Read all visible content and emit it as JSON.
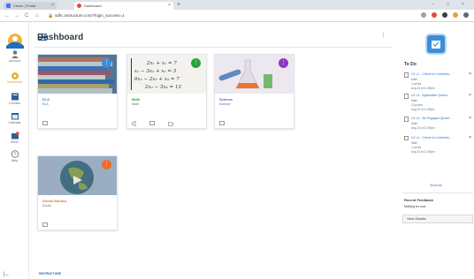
{
  "browser": {
    "tabs": [
      {
        "label": "Clever | Portal",
        "active": false,
        "favicon_color": "#4274f6"
      },
      {
        "label": "Dashboard",
        "active": true,
        "favicon_color": "#e94b3c"
      }
    ],
    "new_tab": "+",
    "window_controls": [
      "–",
      "□",
      "×"
    ],
    "url": "sdhc.instructure.com/?login_success=1",
    "nav_buttons": [
      "←",
      "→",
      "C",
      "⌂"
    ]
  },
  "global_nav": {
    "logo": "canvas-logo",
    "items": [
      {
        "label": "Account",
        "icon": "account-icon",
        "active": false
      },
      {
        "label": "Dashboard",
        "icon": "dashboard-icon",
        "active": true
      },
      {
        "label": "Courses",
        "icon": "courses-icon",
        "active": false
      },
      {
        "label": "Calendar",
        "icon": "calendar-icon",
        "active": false
      },
      {
        "label": "Inbox",
        "icon": "inbox-icon",
        "active": false
      },
      {
        "label": "Help",
        "icon": "help-icon",
        "active": false
      }
    ],
    "collapse": "|←"
  },
  "dashboard": {
    "title": "Dashboard",
    "more": "⋮",
    "cards": [
      {
        "title": "ELA",
        "subtitle": "ELA",
        "color": "#3d8dd8",
        "badge": "",
        "image": "books"
      },
      {
        "title": "Math",
        "subtitle": "Math",
        "color": "#2aa13b",
        "badge": "",
        "image": "equations",
        "equations": [
          "2x₁ + x₂ = 7",
          "x₁ − 3x₂ + x₃ = 3",
          "6x₂ − 2x₃ + x₄ = 7",
          "2x₃ − 3x₄ = 13"
        ]
      },
      {
        "title": "Science",
        "subtitle": "Science",
        "color": "#8b38c2",
        "badge": "",
        "image": "lab"
      },
      {
        "title": "Social Studies",
        "subtitle": "Social",
        "color": "#ee6b2d",
        "badge": "",
        "image": "globe"
      }
    ]
  },
  "sidebar": {
    "todo_title": "To Do",
    "todo": [
      {
        "title": "U1 L1 - Check for Understa...",
        "course": "Math",
        "points": "1 points",
        "due": "Aug 23 at 11:59pm"
      },
      {
        "title": "U1 L4 - Application Questi...",
        "course": "Math",
        "points": "10 points",
        "due": "Aug 23 at 11:59pm"
      },
      {
        "title": "U1 L4 - Be Engaged Questi...",
        "course": "Math",
        "points": "",
        "due": "Aug 23 at 11:59pm"
      },
      {
        "title": "U1 L4 - Check for Understa...",
        "course": "Math",
        "points": "1 points",
        "due": "Aug 23 at 11:59pm"
      }
    ],
    "show_all": "Show All",
    "feedback_title": "Recent Feedback",
    "feedback_text": "Nothing for now",
    "view_grades": "View Grades"
  },
  "footer": {
    "brand": "INSTRUCTURE",
    "links": "Privacy Policy    Acceptable Use Policy    Facebook    Twitter"
  },
  "colors": {
    "link": "#2d72c5",
    "active_nav": "#d5a32a",
    "brand": "#2d5f97"
  }
}
